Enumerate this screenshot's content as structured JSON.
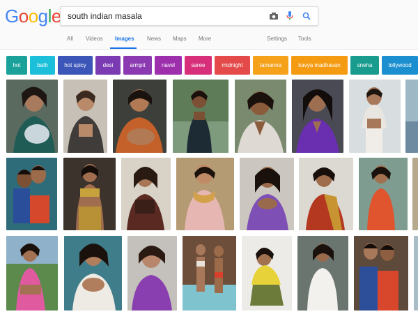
{
  "search": {
    "query": "south indian masala"
  },
  "logo": {
    "text": "Google"
  },
  "tabs": [
    {
      "label": "All"
    },
    {
      "label": "Videos"
    },
    {
      "label": "Images"
    },
    {
      "label": "News"
    },
    {
      "label": "Maps"
    },
    {
      "label": "More"
    },
    {
      "label": "Settings"
    },
    {
      "label": "Tools"
    }
  ],
  "chips": [
    {
      "label": "hot",
      "color": "#1aa29a"
    },
    {
      "label": "bath",
      "color": "#1bbfd9"
    },
    {
      "label": "hot spicy",
      "color": "#3b55b8"
    },
    {
      "label": "desi",
      "color": "#7b3bb3"
    },
    {
      "label": "armpit",
      "color": "#8b3ab2"
    },
    {
      "label": "navel",
      "color": "#9d2fad"
    },
    {
      "label": "saree",
      "color": "#d82f7a"
    },
    {
      "label": "midnight",
      "color": "#e44a4a"
    },
    {
      "label": "tamanna",
      "color": "#f5a11a"
    },
    {
      "label": "kavya madhavan",
      "color": "#f59b12"
    },
    {
      "label": "sneha",
      "color": "#199c8e"
    },
    {
      "label": "tollywood",
      "color": "#1b8fcf"
    }
  ]
}
